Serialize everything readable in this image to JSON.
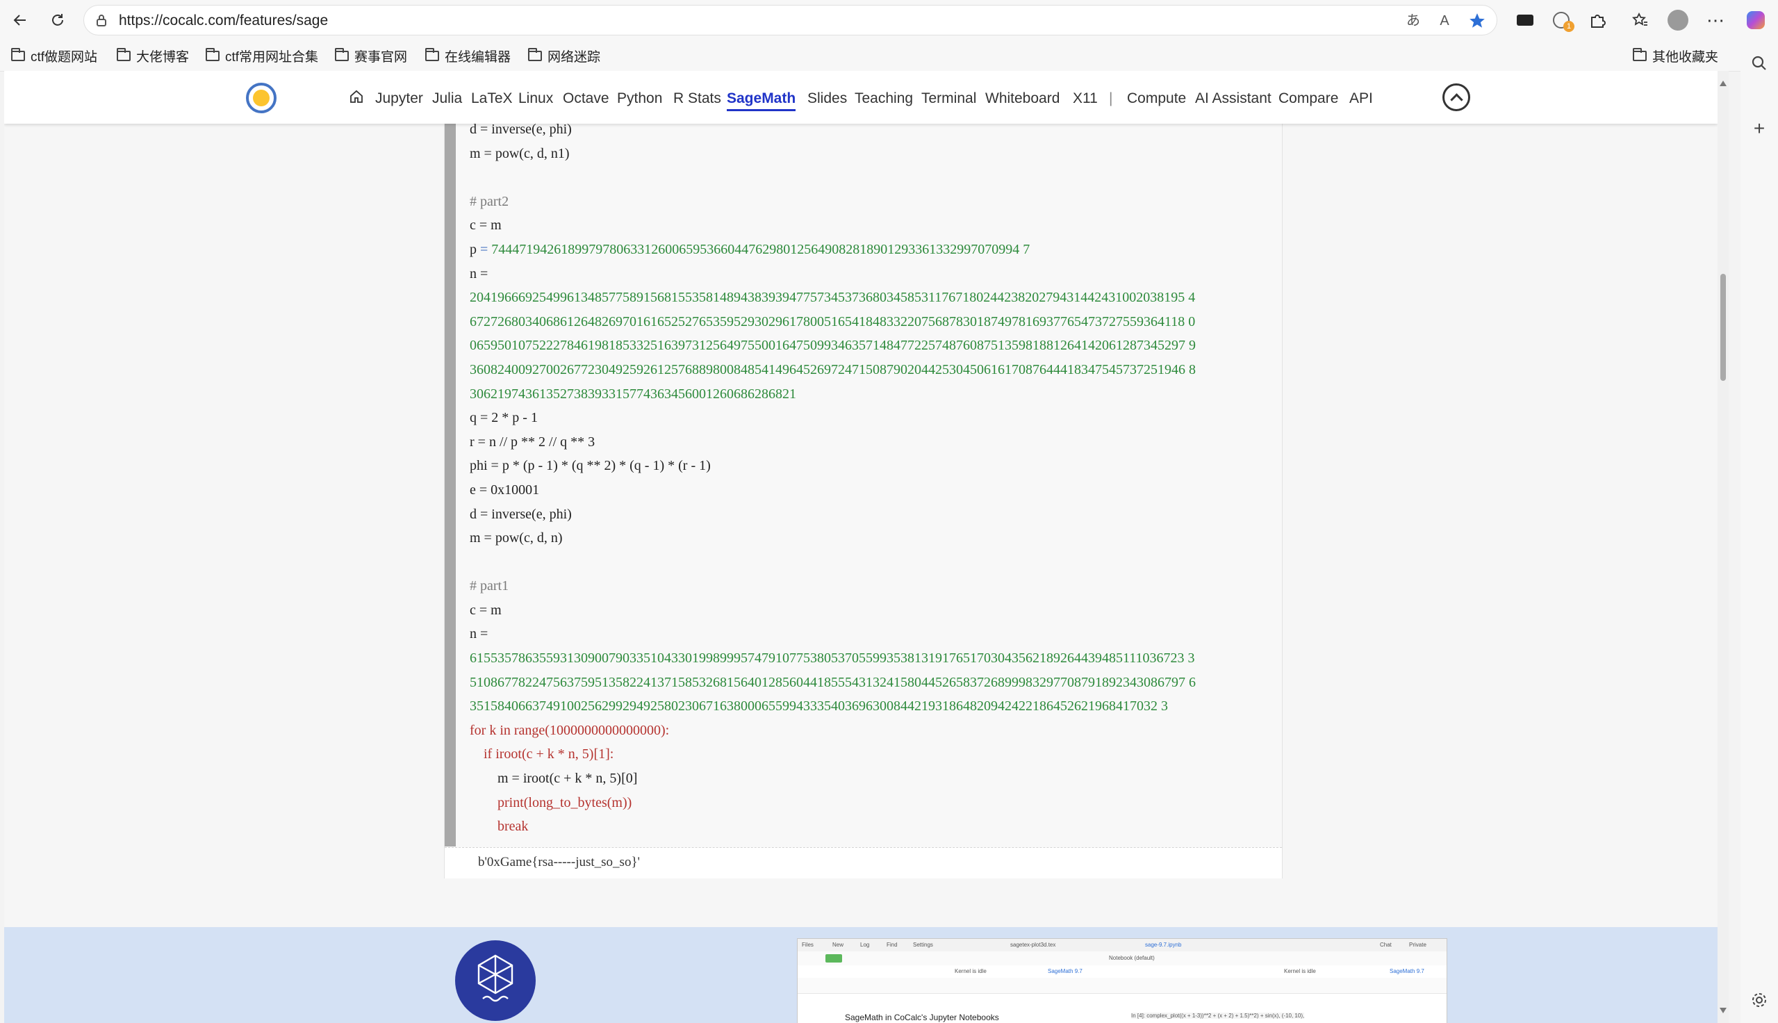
{
  "browser": {
    "url": "https://cocalc.com/features/sage",
    "bookmarks": [
      "ctf做题网站",
      "大佬博客",
      "ctf常用网址合集",
      "赛事官网",
      "在线编辑器",
      "网络迷踪"
    ],
    "other_bookmarks": "其他收藏夹",
    "badge_count": "1"
  },
  "nav": {
    "items": [
      "Jupyter",
      "Julia",
      "LaTeX",
      "Linux",
      "Octave",
      "Python",
      "R Stats",
      "SageMath",
      "Slides",
      "Teaching",
      "Terminal",
      "Whiteboard",
      "X11"
    ],
    "separator": "|",
    "items_right": [
      "Compute",
      "AI Assistant",
      "Compare",
      "API"
    ],
    "active": "SageMath"
  },
  "code": {
    "line_d1": "d = inverse(e, phi)",
    "line_m1": "m = pow(c, d, n1)",
    "comment_part2": "# part2",
    "c_eq_m": "c = m",
    "p_value": "7444719426189979780633126006595366044762980125649082818901293361332997070994 7",
    "n_label": "n =",
    "n2_lines": [
      "2041966692549961348577589156815535814894383939477573453736803458531176718024423820279431442431002038195 4",
      "6727268034068612648269701616525276535952930296178005165418483322075687830187497816937765473727559364118 0",
      "0659501075222784619818533251639731256497550016475099346357148477225748760875135981881264142061287345297 9",
      "3608240092700267723049259261257688980084854149645269724715087902044253045061617087644418347545737251946 8",
      "30621974361352738393315774363456001260686286821"
    ],
    "q_line": "q = 2 * p - 1",
    "r_line": "r = n // p ** 2 // q ** 3",
    "phi_line": "phi = p * (p - 1) * (q ** 2) * (q - 1) * (r - 1)",
    "e_line": "e = 0x10001",
    "d_line": "d = inverse(e, phi)",
    "m_line": "m = pow(c, d, n)",
    "comment_part1": "# part1",
    "n1_lines": [
      "6155357863559313090079033510433019989995747910775380537055993538131917651703043562189264439485111036723 3",
      "5108677822475637595135822413715853268156401285604418555431324158044526583726899983297708791892343086797 6",
      "351584066374910025629929492580230671638000655994333540369630084421931864820942422186452621968417032 3"
    ],
    "for_line": "for k in range(1000000000000000):",
    "if_line": "if iroot(c + k * n, 5)[1]:",
    "m_iroot_line": "m = iroot(c + k * n, 5)[0]",
    "print_line": "print(long_to_bytes(m))",
    "break_line": "break"
  },
  "output": "b'0xGame{rsa-----just_so_so}'",
  "preview": {
    "caption": "SageMath in CoCalc's Jupyter Notebooks",
    "tab1": "sagetex-plot3d.tex",
    "tab2": "sage-9.7.ipynb",
    "menu": [
      "Files",
      "New",
      "Log",
      "Find",
      "Settings"
    ],
    "chat": "Chat",
    "private": "Private",
    "notebook_default": "Notebook (default)",
    "kernel_status": "Kernel is idle",
    "kernel_name": "SageMath 9.7",
    "code_snippet": "In [4]:  complex_plot((x + 1-3))**2 + (x + 2) + 1.5)**2) + sin(x), (-10, 10),"
  },
  "colors": {
    "accent": "#2034c8",
    "lower_bg": "#d4e1f4",
    "sage_logo": "#2a3a9e"
  }
}
